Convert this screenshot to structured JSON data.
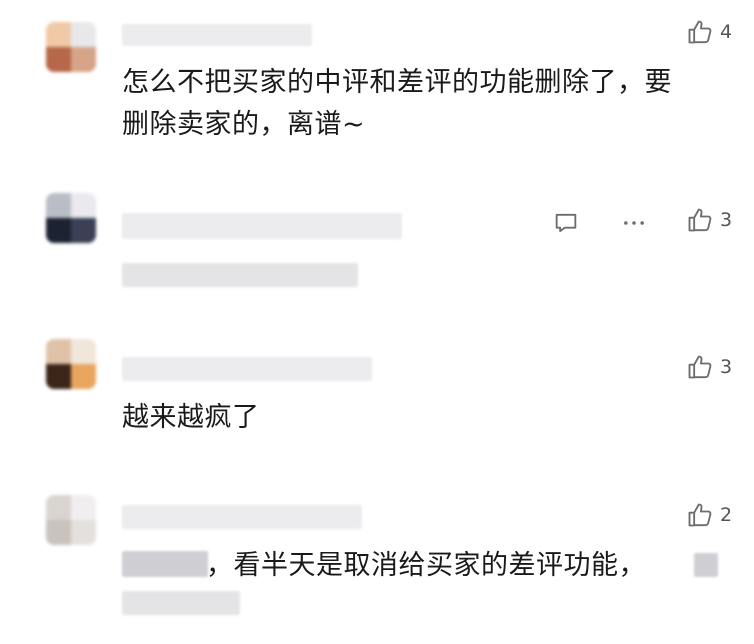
{
  "colors": {
    "text": "#1a1a1a",
    "icon": "#6d6d6d",
    "blur_gray": "#e4e4e6"
  },
  "comments": [
    {
      "text_lines": [
        "怎么不把买家的中评和差评的功能删除了，要",
        "删除卖家的，离谱~"
      ],
      "like_count": "4",
      "icons": [
        "thumbs-up-icon"
      ]
    },
    {
      "text_lines": [],
      "like_count": "3",
      "icons": [
        "comment-icon",
        "more-icon",
        "thumbs-up-icon"
      ]
    },
    {
      "text_lines": [
        "越来越疯了"
      ],
      "like_count": "3",
      "icons": [
        "thumbs-up-icon"
      ]
    },
    {
      "text_lines": [
        "，看半天是取消给买家的差评功能，"
      ],
      "like_count": "2",
      "icons": [
        "thumbs-up-icon"
      ]
    }
  ]
}
